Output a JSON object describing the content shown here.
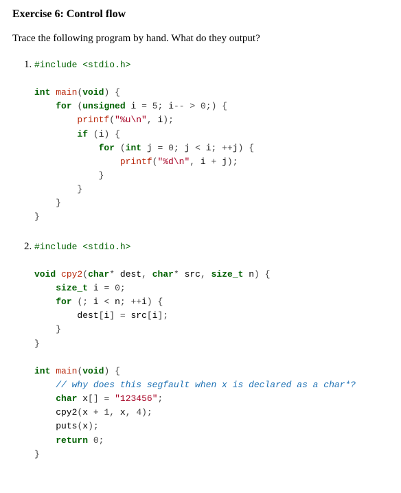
{
  "title": "Exercise 6: Control flow",
  "prompt": "Trace the following program by hand. What do they output?",
  "code1": {
    "include_kw": "#include ",
    "include_path": "<stdio.h>",
    "int_kw": "int",
    "main_fn": "main",
    "void_kw": "void",
    "for_kw": "for",
    "unsigned_kw": "unsigned",
    "num5": "5",
    "num0a": "0",
    "printf_fn": "printf",
    "str_u": "\"%u\\n\"",
    "if_kw": "if",
    "int_kw2": "int",
    "num0b": "0",
    "str_d": "\"%d\\n\""
  },
  "code2": {
    "include_kw": "#include ",
    "include_path": "<stdio.h>",
    "void_kw": "void",
    "cpy2_fn": "cpy2",
    "char_kw": "char",
    "sizet_kw": "size_t",
    "num0": "0",
    "for_kw": "for",
    "int_kw": "int",
    "main_fn": "main",
    "void_kw2": "void",
    "comment": "// why does this segfault when x is declared as a char*?",
    "char_kw2": "char",
    "str_lit": "\"123456\"",
    "num1": "1",
    "num4": "4",
    "puts_fn": "puts",
    "return_kw": "return",
    "num0b": "0"
  }
}
